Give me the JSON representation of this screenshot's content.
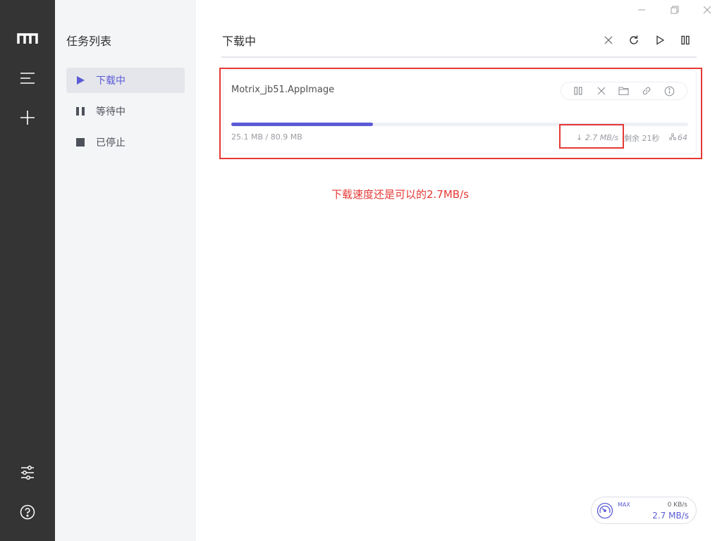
{
  "panel": {
    "title": "任务列表",
    "items": [
      {
        "label": "下载中",
        "active": true
      },
      {
        "label": "等待中",
        "active": false
      },
      {
        "label": "已停止",
        "active": false
      }
    ]
  },
  "main": {
    "title": "下载中"
  },
  "task": {
    "name": "Motrix_jb51.AppImage",
    "size": "25.1 MB / 80.9 MB",
    "progress": 0.31,
    "speed": "↓ 2.7 MB/s",
    "remaining": "剩余 21秒",
    "connections": "64"
  },
  "annotation": {
    "text": "下载速度还是可以的2.7MB/s",
    "color": "#e53935"
  },
  "speedometer": {
    "max_label": "MAX",
    "upload": "0 KB/s",
    "download": "2.7 MB/s"
  },
  "colors": {
    "accent": "#5b5bd6",
    "sidebar": "#343434",
    "panel": "#f4f5f7"
  }
}
